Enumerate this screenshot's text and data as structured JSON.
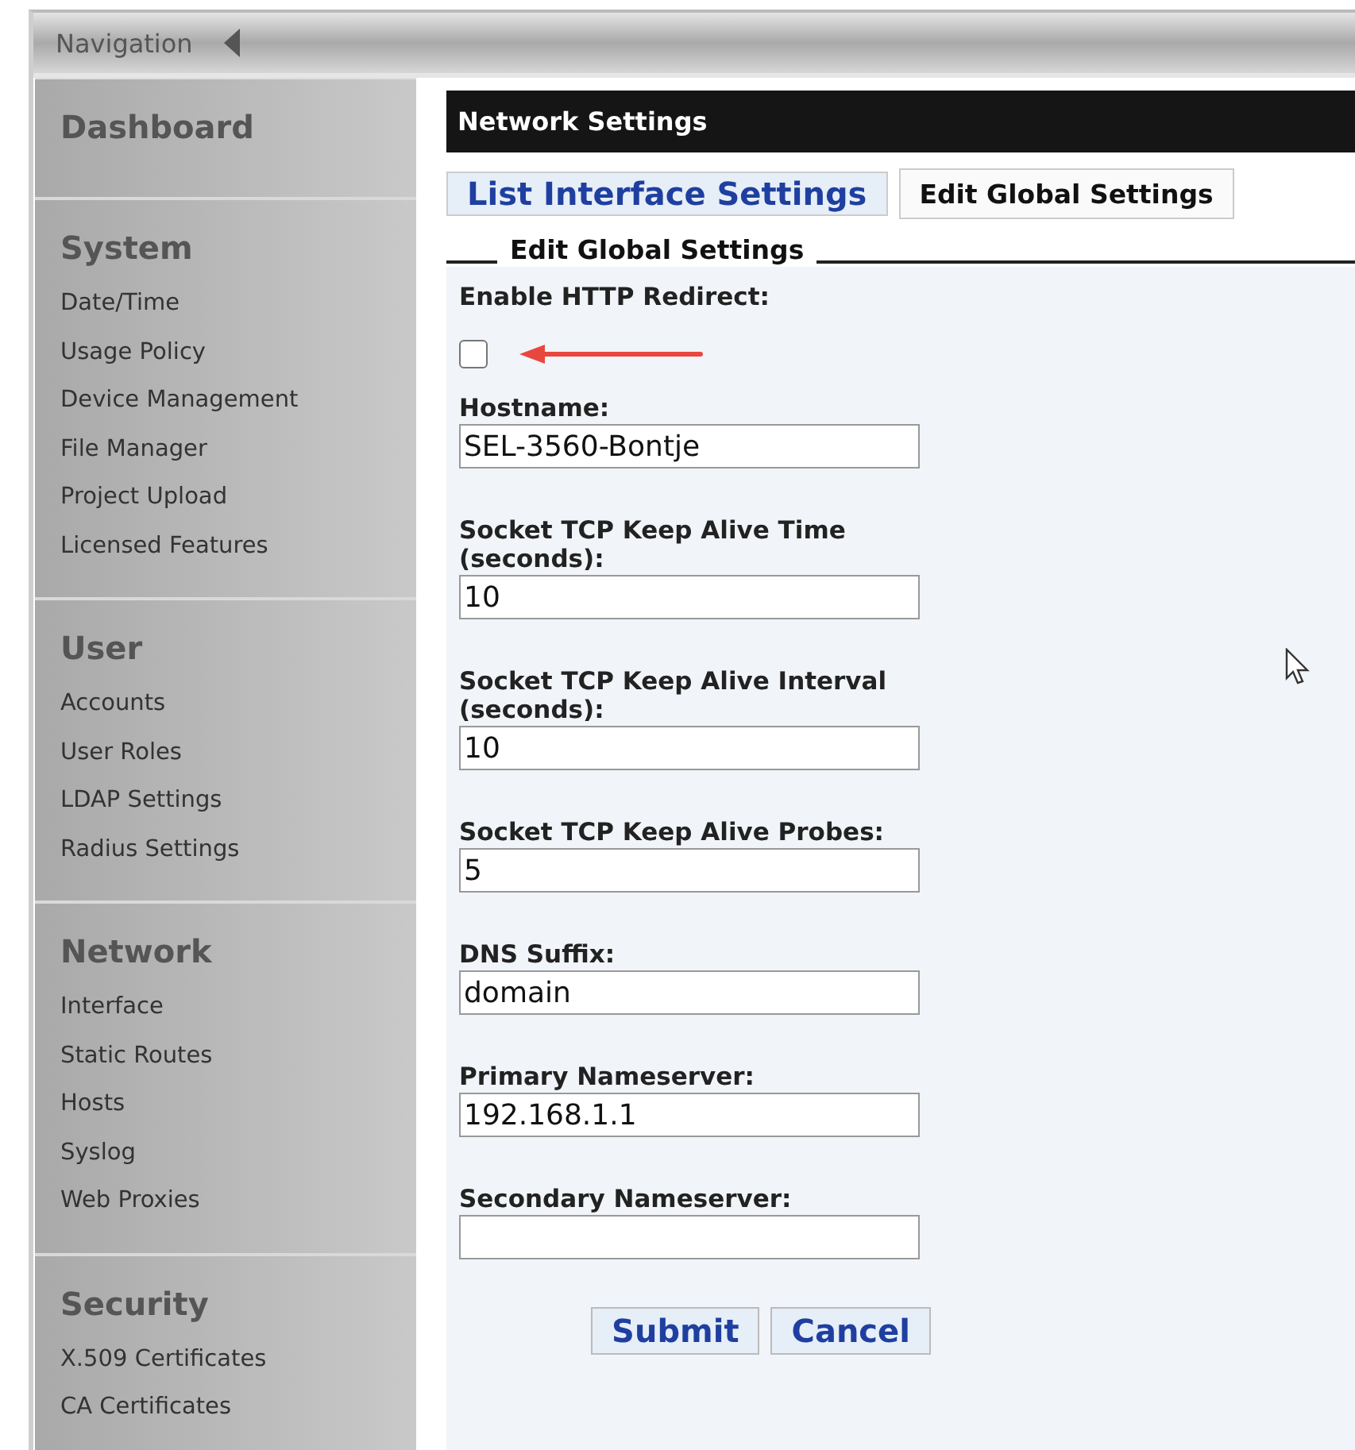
{
  "navigation": {
    "title": "Navigation"
  },
  "sidebar": {
    "sections": [
      {
        "heading": "Dashboard"
      },
      {
        "heading": "System",
        "items": [
          "Date/Time",
          "Usage Policy",
          "Device Management",
          "File Manager",
          "Project Upload",
          "Licensed Features"
        ]
      },
      {
        "heading": "User",
        "items": [
          "Accounts",
          "User Roles",
          "LDAP Settings",
          "Radius Settings"
        ]
      },
      {
        "heading": "Network",
        "items": [
          "Interface",
          "Static Routes",
          "Hosts",
          "Syslog",
          "Web Proxies"
        ]
      },
      {
        "heading": "Security",
        "items": [
          "X.509 Certificates",
          "CA Certificates"
        ]
      }
    ]
  },
  "panel": {
    "title": "Network Settings",
    "tabs": [
      {
        "label": "List Interface Settings",
        "selected": false
      },
      {
        "label": "Edit Global Settings",
        "selected": true
      }
    ],
    "legend": "Edit Global Settings",
    "fields": [
      {
        "kind": "checkbox",
        "label": "Enable HTTP Redirect:",
        "checked": false
      },
      {
        "kind": "text",
        "label": "Hostname:",
        "value": "SEL-3560-Bontje"
      },
      {
        "kind": "text",
        "label": "Socket TCP Keep Alive Time (seconds):",
        "value": "10"
      },
      {
        "kind": "text",
        "label": "Socket TCP Keep Alive Interval (seconds):",
        "value": "10"
      },
      {
        "kind": "text",
        "label": "Socket TCP Keep Alive Probes:",
        "value": "5"
      },
      {
        "kind": "text",
        "label": "DNS Suffix:",
        "value": "domain"
      },
      {
        "kind": "text",
        "label": "Primary Nameserver:",
        "value": "192.168.1.1"
      },
      {
        "kind": "text",
        "label": "Secondary Nameserver:"
      }
    ],
    "buttons": [
      "Submit",
      "Cancel"
    ]
  }
}
